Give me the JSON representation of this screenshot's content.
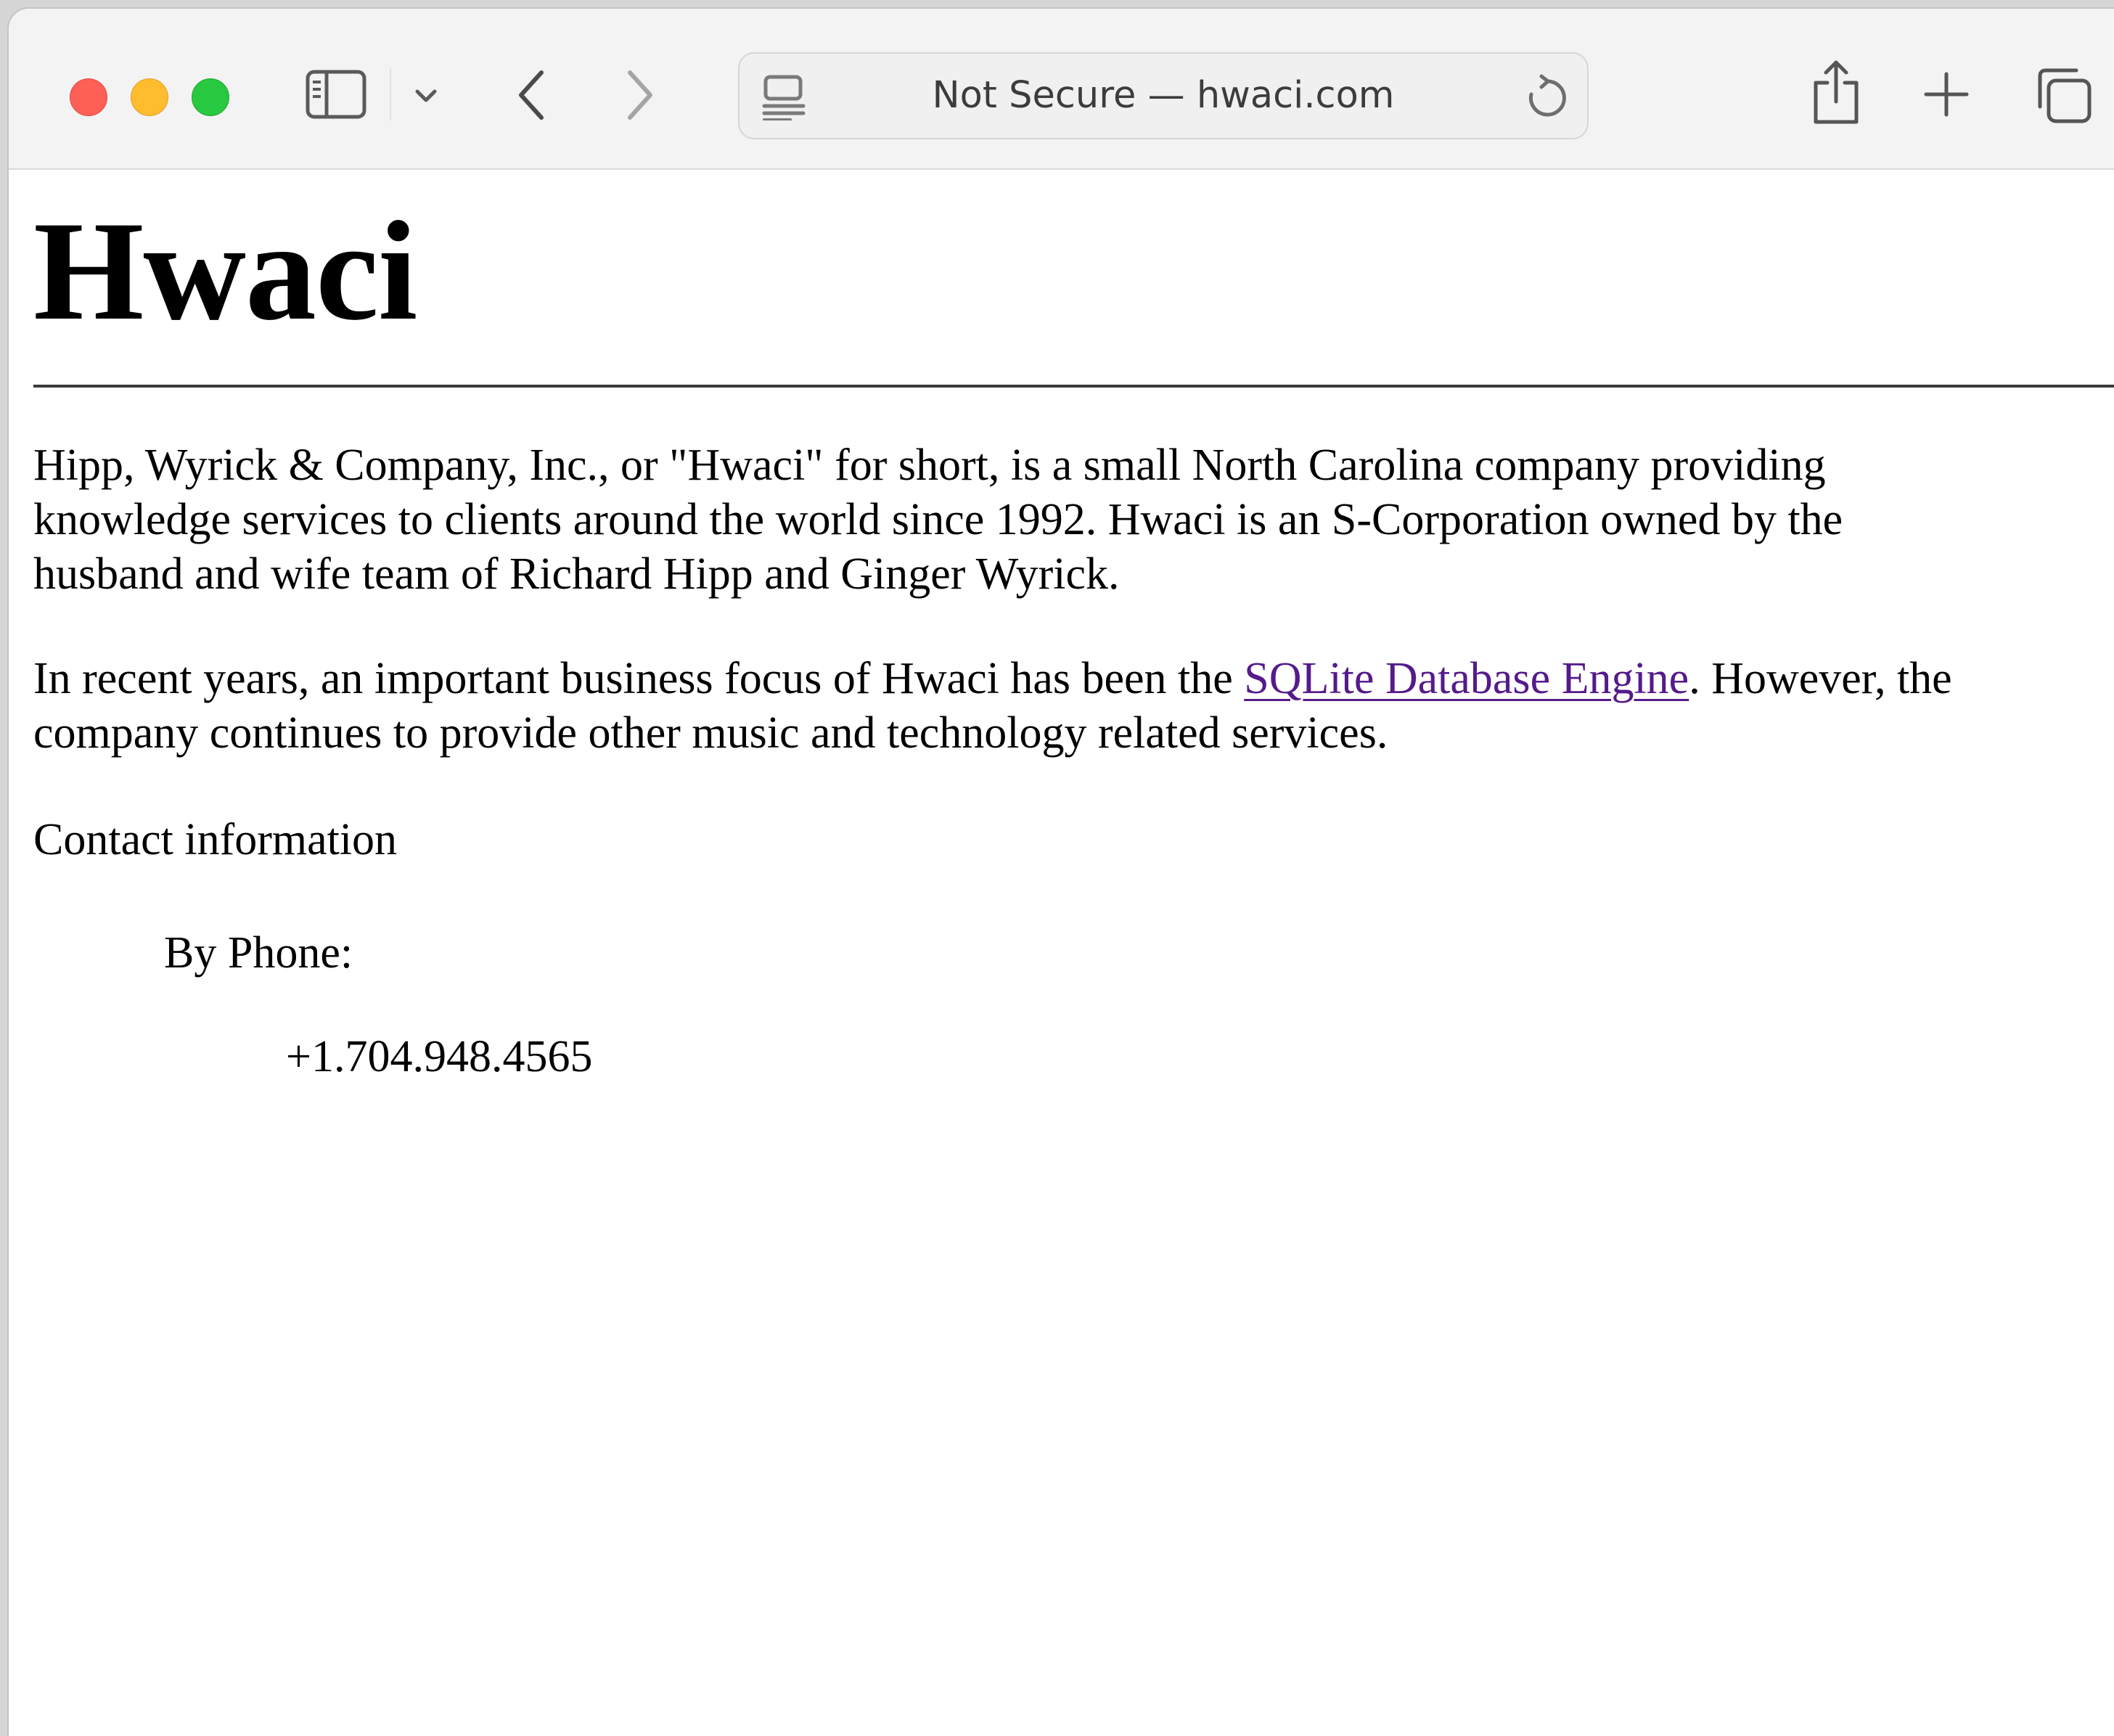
{
  "browser": {
    "address_text": "Not Secure — hwaci.com",
    "icons": {
      "close": "close-traffic-light",
      "minimize": "minimize-traffic-light",
      "maximize": "maximize-traffic-light",
      "sidebar": "sidebar-icon",
      "tab_group_menu": "chevron-down-icon",
      "back": "chevron-left-icon",
      "forward": "chevron-right-icon",
      "reader": "reader-icon",
      "reload": "reload-icon",
      "share": "share-icon",
      "new_tab": "plus-icon",
      "tabs_overview": "tabs-icon"
    },
    "colors": {
      "close": "#fe5f57",
      "minimize": "#febc2e",
      "maximize": "#28c840"
    }
  },
  "page": {
    "title": "Hwaci",
    "intro_lines": [
      "Hipp, Wyrick & Company, Inc., or \"Hwaci\" for short, is a small North Carolina company providing",
      "knowledge services to clients around the world since 1992. Hwaci is an S-Corporation owned by the",
      "husband and wife team of Richard Hipp and Ginger Wyrick."
    ],
    "focus": {
      "before_link": "In recent years, an important business focus of Hwaci has been the ",
      "link_text": "SQLite Database Engine",
      "after_link": ". However, the",
      "line2": "company continues to provide other music and technology related services.",
      "link_color": "#551a8b"
    },
    "contact_heading": "Contact information",
    "phone_label": "By Phone:",
    "phone_number": "+1.704.948.4565"
  }
}
